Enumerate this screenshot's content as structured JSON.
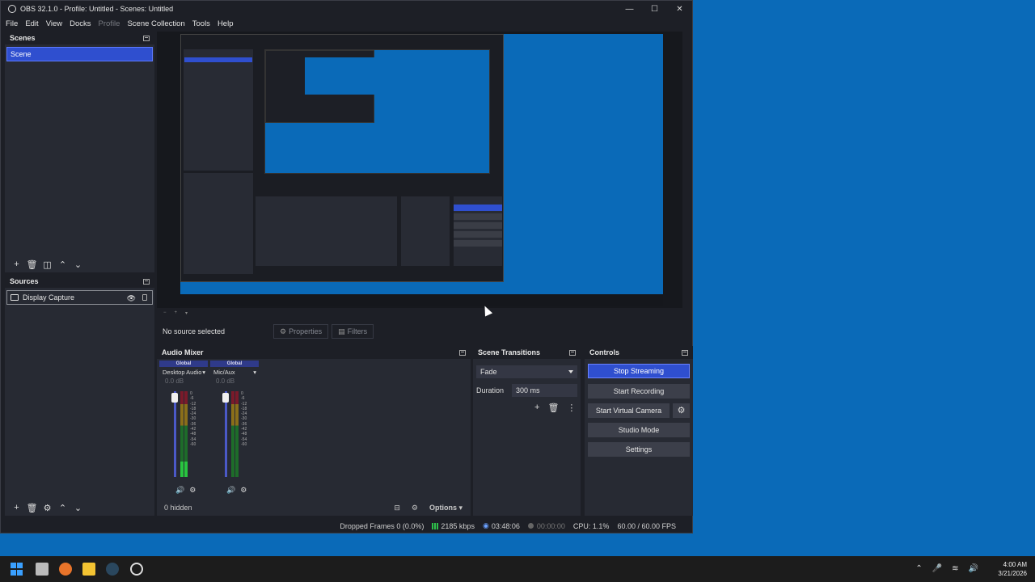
{
  "window": {
    "title": "OBS 32.1.0 - Profile: Untitled - Scenes: Untitled",
    "controls": [
      "—",
      "☐",
      "✕"
    ]
  },
  "menu": [
    {
      "label": "File",
      "enabled": true
    },
    {
      "label": "Edit",
      "enabled": true
    },
    {
      "label": "View",
      "enabled": true
    },
    {
      "label": "Docks",
      "enabled": true
    },
    {
      "label": "Profile",
      "enabled": false
    },
    {
      "label": "Scene Collection",
      "enabled": true
    },
    {
      "label": "Tools",
      "enabled": true
    },
    {
      "label": "Help",
      "enabled": true
    }
  ],
  "scenes": {
    "header": "Scenes",
    "items": [
      "Scene"
    ]
  },
  "sources": {
    "header": "Sources",
    "items": [
      "Display Capture"
    ]
  },
  "context": {
    "no_source": "No source selected",
    "properties": "Properties",
    "filters": "Filters"
  },
  "mixer": {
    "header": "Audio Mixer",
    "channels": [
      {
        "global": "Global",
        "name": "Desktop Audio",
        "db": "0.0 dB",
        "level": 0.18
      },
      {
        "global": "Global",
        "name": "Mic/Aux",
        "db": "0.0 dB",
        "level": 0.0
      }
    ],
    "scale": [
      "0",
      "-6",
      "-12",
      "-18",
      "-24",
      "-30",
      "-36",
      "-42",
      "-48",
      "-54",
      "-60"
    ],
    "hidden": "0 hidden",
    "options": "Options"
  },
  "transitions": {
    "header": "Scene Transitions",
    "selected": "Fade",
    "duration_label": "Duration",
    "duration_value": "300 ms"
  },
  "controls": {
    "header": "Controls",
    "stop_streaming": "Stop Streaming",
    "start_recording": "Start Recording",
    "start_virtual_camera": "Start Virtual Camera",
    "studio_mode": "Studio Mode",
    "settings": "Settings"
  },
  "status": {
    "dropped": "Dropped Frames 0 (0.0%)",
    "bitrate": "2185 kbps",
    "stream_time": "03:48:06",
    "rec_time": "00:00:00",
    "cpu": "CPU: 1.1%",
    "fps": "60.00 / 60.00 FPS"
  },
  "clock": {
    "time": "4:00 AM",
    "date": "3/21/2026"
  },
  "colors": {
    "accent": "#2f4fcf",
    "desktop": "#0a6ab8",
    "panel": "#272a33"
  }
}
